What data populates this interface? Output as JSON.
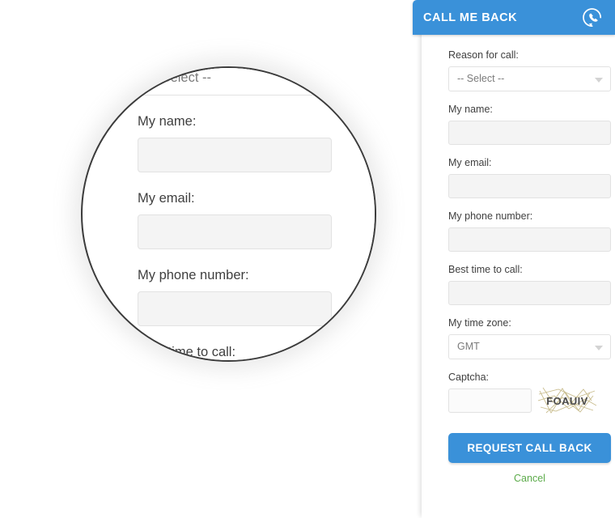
{
  "panel": {
    "header": {
      "title": "CALL ME BACK",
      "icon": "phone-callback-icon"
    },
    "fields": [
      {
        "key": "reason",
        "label": "Reason for call:",
        "type": "select",
        "value": "-- Select --"
      },
      {
        "key": "name",
        "label": "My name:",
        "type": "text",
        "value": "",
        "placeholder": ""
      },
      {
        "key": "email",
        "label": "My email:",
        "type": "text",
        "value": "",
        "placeholder": ""
      },
      {
        "key": "phone",
        "label": "My phone number:",
        "type": "text",
        "value": "",
        "placeholder": ""
      },
      {
        "key": "best_time",
        "label": "Best time to call:",
        "type": "text",
        "value": "",
        "placeholder": ""
      },
      {
        "key": "time_zone",
        "label": "My time zone:",
        "type": "select",
        "value": "GMT"
      }
    ],
    "captcha": {
      "label": "Captcha:",
      "value": "",
      "placeholder": "",
      "image_text": "FOAUIV"
    },
    "submit_label": "REQUEST CALL BACK",
    "cancel_label": "Cancel"
  },
  "magnifier": {
    "fields": [
      {
        "key": "reason_zoom",
        "label": "",
        "type": "select",
        "value": "-- Select --"
      },
      {
        "key": "name_zoom",
        "label": "My name:",
        "type": "text",
        "value": ""
      },
      {
        "key": "email_zoom",
        "label": "My email:",
        "type": "text",
        "value": ""
      },
      {
        "key": "phone_zoom",
        "label": "My phone number:",
        "type": "text",
        "value": ""
      },
      {
        "key": "best_time_zoom",
        "label": "Best time to call:",
        "type": "text",
        "value": ""
      }
    ]
  },
  "colors": {
    "accent_blue": "#3a91d9",
    "link_green": "#5cab4a",
    "input_fill": "#f4f4f4",
    "input_border": "#e2e2e2",
    "label_text": "#3f3f3f",
    "magnifier_ring": "#3b3b3b",
    "captcha_text": "#4a4a4a",
    "captcha_noise": "#c9bd8e"
  }
}
